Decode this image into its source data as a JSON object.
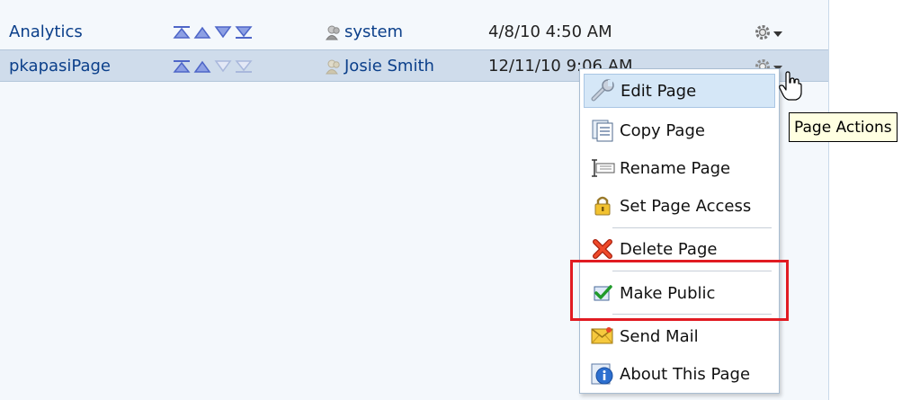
{
  "rows": [
    {
      "name": "Analytics",
      "owner": "system",
      "date": "4/8/10 4:50 AM",
      "selected": false
    },
    {
      "name": "pkapasiPage",
      "owner": "Josie Smith",
      "date": "12/11/10 9:06 AM",
      "selected": true
    }
  ],
  "menu": {
    "items": [
      {
        "label": "Edit Page",
        "icon": "wrench-icon"
      },
      {
        "label": "Copy Page",
        "icon": "copy-page-icon"
      },
      {
        "label": "Rename Page",
        "icon": "rename-icon"
      },
      {
        "label": "Set Page Access",
        "icon": "lock-icon"
      },
      {
        "label": "Delete Page",
        "icon": "delete-x-icon"
      },
      {
        "label": "Make Public",
        "icon": "checkbox-check-icon"
      },
      {
        "label": "Send Mail",
        "icon": "mail-icon"
      },
      {
        "label": "About This Page",
        "icon": "info-icon"
      }
    ],
    "hovered_item": "Edit Page",
    "highlighted_item": "Make Public"
  },
  "tooltip": {
    "text": "Page Actions"
  },
  "colors": {
    "link": "#0b3f8a",
    "selected_row": "#cfdceb",
    "highlight_box": "#e11b22",
    "arrow_active": "#4e66c8",
    "arrow_inactive": "#a9b8dc"
  }
}
